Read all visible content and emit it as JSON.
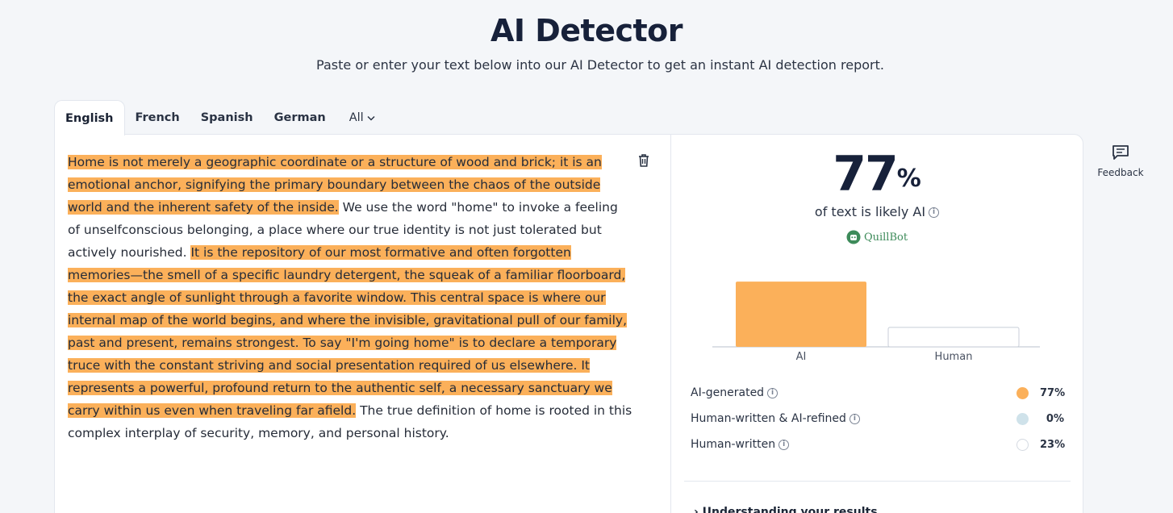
{
  "header": {
    "title": "AI Detector",
    "subtitle": "Paste or enter your text below into our AI Detector to get an instant AI detection report."
  },
  "language_tabs": [
    {
      "label": "English",
      "active": true
    },
    {
      "label": "French",
      "active": false
    },
    {
      "label": "Spanish",
      "active": false
    },
    {
      "label": "German",
      "active": false
    },
    {
      "label": "All",
      "active": false
    }
  ],
  "editor": {
    "segments": [
      {
        "text": "Home is not merely a geographic coordinate or a structure of wood and brick; it is an emotional anchor, signifying the primary boundary between the chaos of the outside world and the inherent safety of the inside.",
        "ai": true
      },
      {
        "text": " We use the word \"home\" to invoke a feeling of unselfconscious belonging, a place where our true identity is not just tolerated but actively nourished. ",
        "ai": false
      },
      {
        "text": "It is the repository of our most formative and often forgotten memories—the smell of a specific laundry detergent, the squeak of a familiar floorboard, the exact angle of sunlight through a favorite window. This central space is where our internal map of the world begins, and where the invisible, gravitational pull of our family, past and present, remains strongest. To say \"I'm going home\" is to declare a temporary truce with the constant striving and social presentation required of us elsewhere. It represents a powerful, profound return to the authentic self, a necessary sanctuary we carry within us even when traveling far afield.",
        "ai": true
      },
      {
        "text": " The true definition of home is rooted in this complex interplay of security, memory, and personal history.",
        "ai": false
      }
    ]
  },
  "result": {
    "score": "77",
    "score_unit": "%",
    "caption": "of text is likely AI",
    "brand": "QuillBot",
    "understanding_label": "Understanding your results"
  },
  "chart_data": {
    "type": "bar",
    "categories": [
      "AI",
      "Human"
    ],
    "values": [
      77,
      23
    ],
    "colors": [
      "#fbb05a",
      "#ffffff"
    ],
    "ylim": [
      0,
      100
    ]
  },
  "breakdown": [
    {
      "label": "AI-generated",
      "value": "77%",
      "color": "#fbb05a"
    },
    {
      "label": "Human-written & AI-refined",
      "value": "0%",
      "color": "#cfe2ea"
    },
    {
      "label": "Human-written",
      "value": "23%",
      "color": "#ffffff"
    }
  ],
  "sidebar": {
    "feedback_label": "Feedback"
  },
  "colors": {
    "highlight": "#fbb05a",
    "title": "#17213a",
    "background": "#f4f6f9"
  }
}
